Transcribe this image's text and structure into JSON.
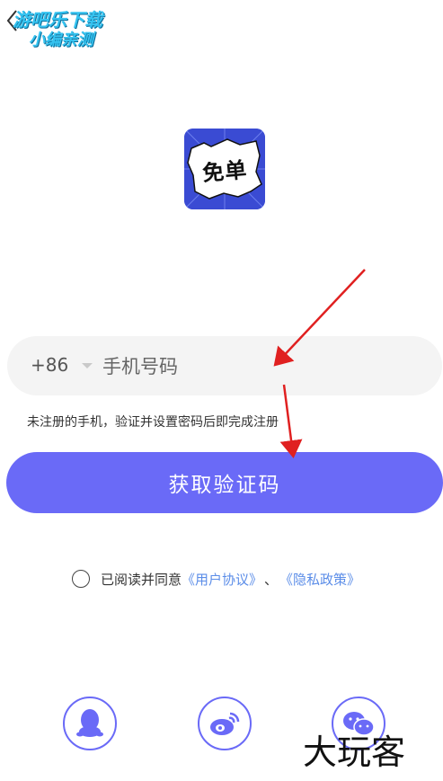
{
  "watermark": {
    "line1": "游吧乐下载",
    "line2": "小编亲测"
  },
  "logo": {
    "text": "免单"
  },
  "phone": {
    "country_code": "+86",
    "placeholder": "手机号码",
    "value": ""
  },
  "hint": "未注册的手机，验证并设置密码后即完成注册",
  "submit_label": "获取验证码",
  "agreement": {
    "prefix": "已阅读并同意",
    "user_agreement": "《用户协议》",
    "separator": "、",
    "privacy_policy": "《隐私政策》",
    "checked": false
  },
  "social": [
    "qq-login",
    "weibo-login",
    "wechat-login"
  ],
  "brand": "大玩客",
  "colors": {
    "primary": "#6a6af7",
    "link": "#5b8de8",
    "input_bg": "#f4f4f4",
    "annotation": "#e02020"
  }
}
